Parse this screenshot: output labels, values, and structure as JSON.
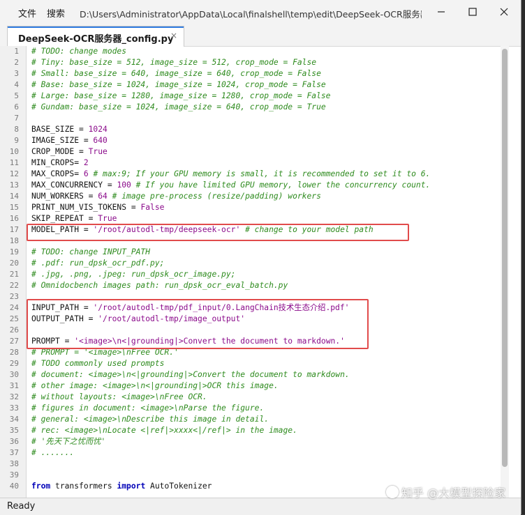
{
  "window": {
    "menu": [
      "文件",
      "搜索"
    ],
    "path": "D:\\Users\\Administrator\\AppData\\Local\\finalshell\\temp\\edit\\DeepSeek-OCR服务器..."
  },
  "tab": {
    "label": "DeepSeek-OCR服务器_config.py",
    "close": "×"
  },
  "editor": {
    "lines": [
      {
        "n": "1",
        "parts": [
          {
            "t": "# TODO: change modes",
            "c": "cm"
          }
        ]
      },
      {
        "n": "2",
        "parts": [
          {
            "t": "# Tiny: base_size = 512, image_size = 512, crop_mode = False",
            "c": "cm"
          }
        ]
      },
      {
        "n": "3",
        "parts": [
          {
            "t": "# Small: base_size = 640, image_size = 640, crop_mode = False",
            "c": "cm"
          }
        ]
      },
      {
        "n": "4",
        "parts": [
          {
            "t": "# Base: base_size = 1024, image_size = 1024, crop_mode = False",
            "c": "cm"
          }
        ]
      },
      {
        "n": "5",
        "parts": [
          {
            "t": "# Large: base_size = 1280, image_size = 1280, crop_mode = False",
            "c": "cm"
          }
        ]
      },
      {
        "n": "6",
        "parts": [
          {
            "t": "# Gundam: base_size = 1024, image_size = 640, crop_mode = True",
            "c": "cm"
          }
        ]
      },
      {
        "n": "7",
        "parts": []
      },
      {
        "n": "8",
        "parts": [
          {
            "t": "BASE_SIZE = ",
            "c": ""
          },
          {
            "t": "1024",
            "c": "num"
          }
        ]
      },
      {
        "n": "9",
        "parts": [
          {
            "t": "IMAGE_SIZE = ",
            "c": ""
          },
          {
            "t": "640",
            "c": "num"
          }
        ]
      },
      {
        "n": "10",
        "parts": [
          {
            "t": "CROP_MODE = ",
            "c": ""
          },
          {
            "t": "True",
            "c": "kwv"
          }
        ]
      },
      {
        "n": "11",
        "parts": [
          {
            "t": "MIN_CROPS= ",
            "c": ""
          },
          {
            "t": "2",
            "c": "num"
          }
        ]
      },
      {
        "n": "12",
        "parts": [
          {
            "t": "MAX_CROPS= ",
            "c": ""
          },
          {
            "t": "6",
            "c": "num"
          },
          {
            "t": " # max:9; If your GPU memory is small, it is recommended to set it to 6.",
            "c": "cm"
          }
        ]
      },
      {
        "n": "13",
        "parts": [
          {
            "t": "MAX_CONCURRENCY = ",
            "c": ""
          },
          {
            "t": "100",
            "c": "num"
          },
          {
            "t": " # If you have limited GPU memory, lower the concurrency count.",
            "c": "cm"
          }
        ]
      },
      {
        "n": "14",
        "parts": [
          {
            "t": "NUM_WORKERS = ",
            "c": ""
          },
          {
            "t": "64",
            "c": "num"
          },
          {
            "t": " # image pre-process (resize/padding) workers",
            "c": "cm"
          }
        ]
      },
      {
        "n": "15",
        "parts": [
          {
            "t": "PRINT_NUM_VIS_TOKENS = ",
            "c": ""
          },
          {
            "t": "False",
            "c": "kwv"
          }
        ]
      },
      {
        "n": "16",
        "parts": [
          {
            "t": "SKIP_REPEAT = ",
            "c": ""
          },
          {
            "t": "True",
            "c": "kwv"
          }
        ]
      },
      {
        "n": "17",
        "parts": [
          {
            "t": "MODEL_PATH = ",
            "c": ""
          },
          {
            "t": "'/root/autodl-tmp/deepseek-ocr'",
            "c": "str"
          },
          {
            "t": " # change to your model path",
            "c": "cm"
          }
        ]
      },
      {
        "n": "18",
        "parts": []
      },
      {
        "n": "19",
        "parts": [
          {
            "t": "# TODO: change INPUT_PATH",
            "c": "cm"
          }
        ]
      },
      {
        "n": "20",
        "parts": [
          {
            "t": "# .pdf: run_dpsk_ocr_pdf.py;",
            "c": "cm"
          }
        ]
      },
      {
        "n": "21",
        "parts": [
          {
            "t": "# .jpg, .png, .jpeg: run_dpsk_ocr_image.py;",
            "c": "cm"
          }
        ]
      },
      {
        "n": "22",
        "parts": [
          {
            "t": "# Omnidocbench images path: run_dpsk_ocr_eval_batch.py",
            "c": "cm"
          }
        ]
      },
      {
        "n": "23",
        "parts": []
      },
      {
        "n": "24",
        "parts": [
          {
            "t": "INPUT_PATH = ",
            "c": ""
          },
          {
            "t": "'/root/autodl-tmp/pdf_input/0.LangChain技术生态介绍.pdf'",
            "c": "str"
          }
        ]
      },
      {
        "n": "25",
        "parts": [
          {
            "t": "OUTPUT_PATH = ",
            "c": ""
          },
          {
            "t": "'/root/autodl-tmp/image_output'",
            "c": "str"
          }
        ]
      },
      {
        "n": "26",
        "parts": []
      },
      {
        "n": "27",
        "parts": [
          {
            "t": "PROMPT = ",
            "c": ""
          },
          {
            "t": "'<image>\\n<|grounding|>Convert the document to markdown.'",
            "c": "str"
          }
        ]
      },
      {
        "n": "28",
        "parts": [
          {
            "t": "# PROMPT = '<image>\\nFree OCR.'",
            "c": "cm"
          }
        ]
      },
      {
        "n": "29",
        "parts": [
          {
            "t": "# TODO commonly used prompts",
            "c": "cm"
          }
        ]
      },
      {
        "n": "30",
        "parts": [
          {
            "t": "# document: <image>\\n<|grounding|>Convert the document to markdown.",
            "c": "cm"
          }
        ]
      },
      {
        "n": "31",
        "parts": [
          {
            "t": "# other image: <image>\\n<|grounding|>OCR this image.",
            "c": "cm"
          }
        ]
      },
      {
        "n": "32",
        "parts": [
          {
            "t": "# without layouts: <image>\\nFree OCR.",
            "c": "cm"
          }
        ]
      },
      {
        "n": "33",
        "parts": [
          {
            "t": "# figures in document: <image>\\nParse the figure.",
            "c": "cm"
          }
        ]
      },
      {
        "n": "34",
        "parts": [
          {
            "t": "# general: <image>\\nDescribe this image in detail.",
            "c": "cm"
          }
        ]
      },
      {
        "n": "35",
        "parts": [
          {
            "t": "# rec: <image>\\nLocate <|ref|>xxxx<|/ref|> in the image.",
            "c": "cm"
          }
        ]
      },
      {
        "n": "36",
        "parts": [
          {
            "t": "# '先天下之忧而忧'",
            "c": "cm"
          }
        ]
      },
      {
        "n": "37",
        "parts": [
          {
            "t": "# .......",
            "c": "cm"
          }
        ]
      },
      {
        "n": "38",
        "parts": []
      },
      {
        "n": "39",
        "parts": []
      },
      {
        "n": "40",
        "parts": [
          {
            "t": "from",
            "c": "kw"
          },
          {
            "t": " transformers ",
            "c": ""
          },
          {
            "t": "import",
            "c": "kw"
          },
          {
            "t": " AutoTokenizer",
            "c": ""
          }
        ]
      }
    ]
  },
  "status": {
    "text": "Ready"
  },
  "watermark": {
    "text": "知乎 @大模型探险家"
  },
  "colors": {
    "highlight_box": "#e14b4b",
    "comment": "#2e8b1e",
    "string": "#8b0b8b",
    "keyword": "#0000b8"
  }
}
